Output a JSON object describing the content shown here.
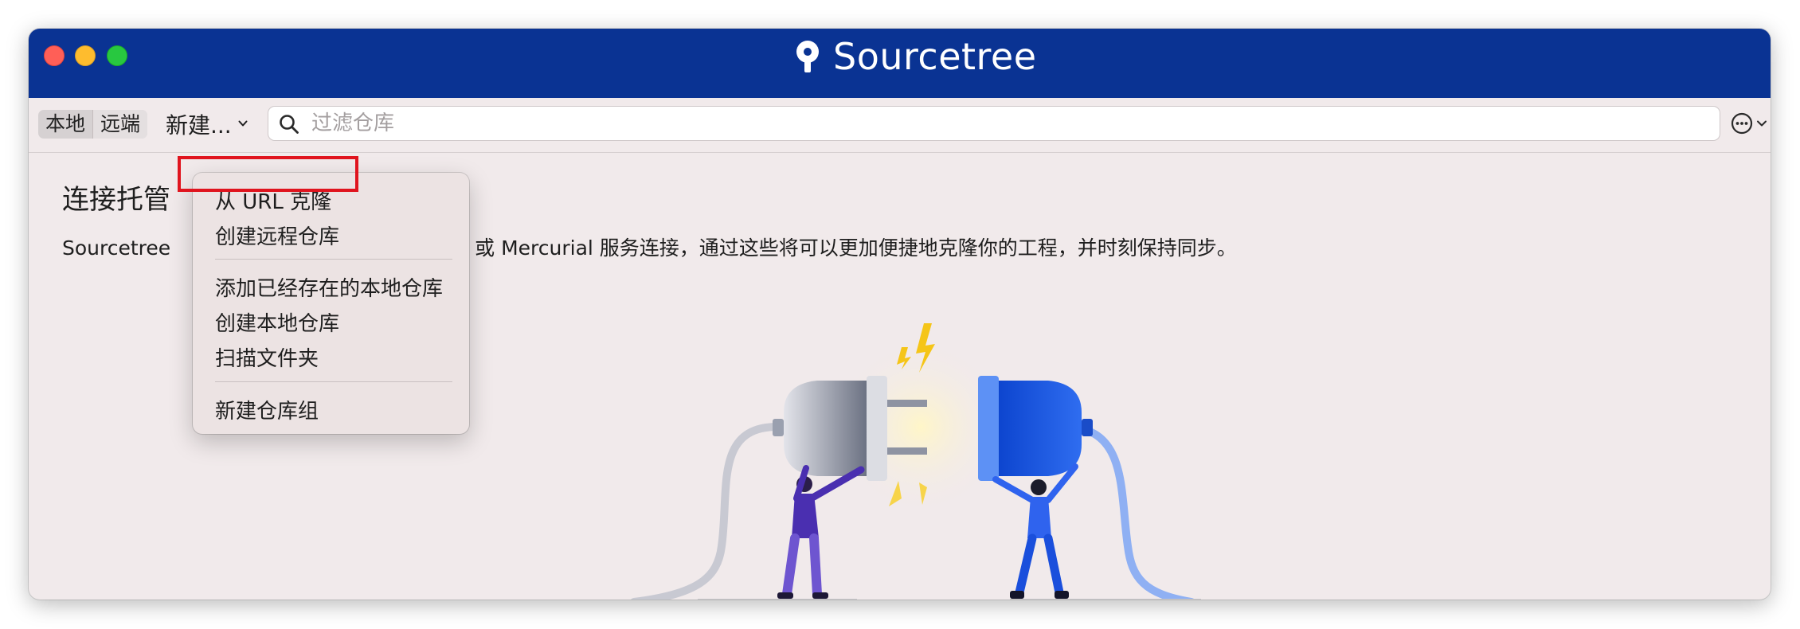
{
  "app": {
    "title": "Sourcetree"
  },
  "toolbar": {
    "tabs": [
      {
        "label": "本地"
      },
      {
        "label": "远端"
      }
    ],
    "new_label": "新建...",
    "search_placeholder": "过滤仓库"
  },
  "content": {
    "title_visible": "连接托管",
    "description_start": "Sourcetree",
    "description_end": "Git 或 Mercurial 服务连接，通过这些将可以更加便捷地克隆你的工程，并时刻保持同步。"
  },
  "menu": {
    "items": [
      {
        "label": "从 URL 克隆"
      },
      {
        "label": "创建远程仓库"
      },
      {
        "label": "添加已经存在的本地仓库"
      },
      {
        "label": "创建本地仓库"
      },
      {
        "label": "扫描文件夹"
      },
      {
        "label": "新建仓库组"
      }
    ]
  },
  "colors": {
    "titlebar": "#0a3393",
    "window_bg": "#f1eaeb",
    "highlight": "#e0141e",
    "plug_blue": "#1a5be0",
    "person_purple": "#4a2fb0"
  },
  "icons": [
    "sourcetree-logo-icon",
    "search-icon",
    "chevron-down-icon",
    "more-options-icon"
  ]
}
